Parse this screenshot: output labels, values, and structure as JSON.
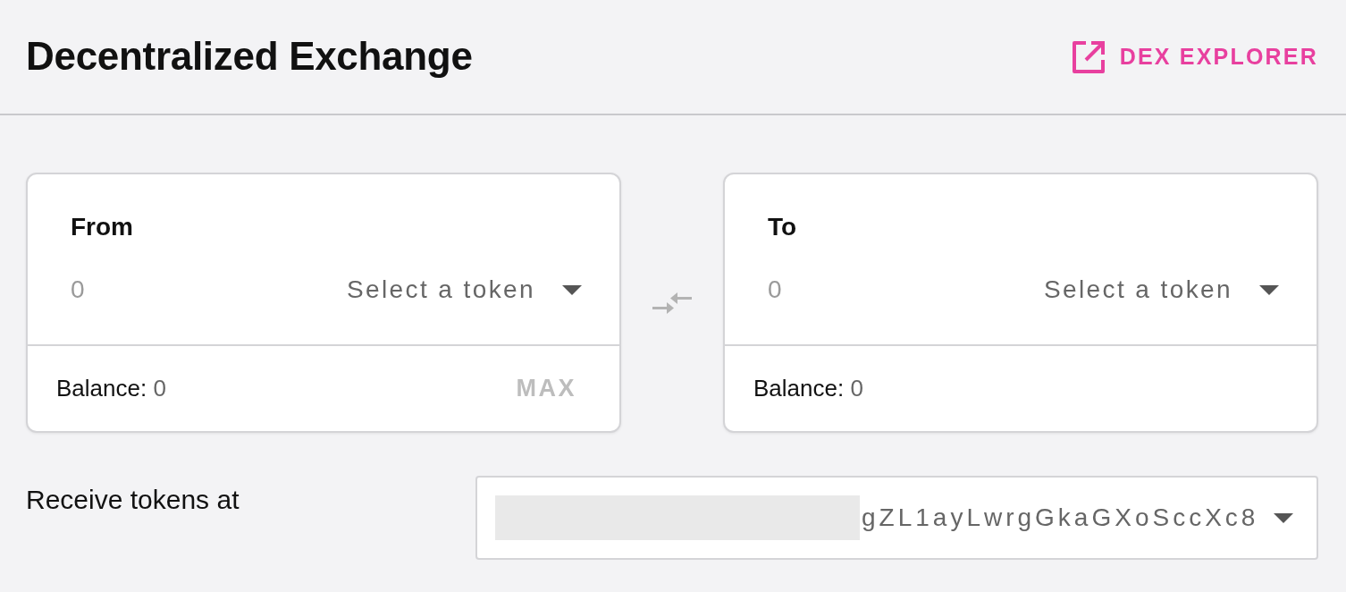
{
  "header": {
    "title": "Decentralized Exchange",
    "explorer_link": "DEX EXPLORER"
  },
  "panels": [
    {
      "label": "From",
      "amount_placeholder": "0",
      "token_select": "Select a token",
      "balance_label": "Balance:",
      "balance_value": "0",
      "max_button": {
        "label": "MAX",
        "disabled": true
      }
    },
    {
      "label": "To",
      "amount_placeholder": "0",
      "token_select": "Select a token",
      "balance_label": "Balance:",
      "balance_value": "0"
    }
  ],
  "receive": {
    "label": "Receive tokens at",
    "address": "gZL1ayLwrgGkaGXoSccXc8"
  }
}
